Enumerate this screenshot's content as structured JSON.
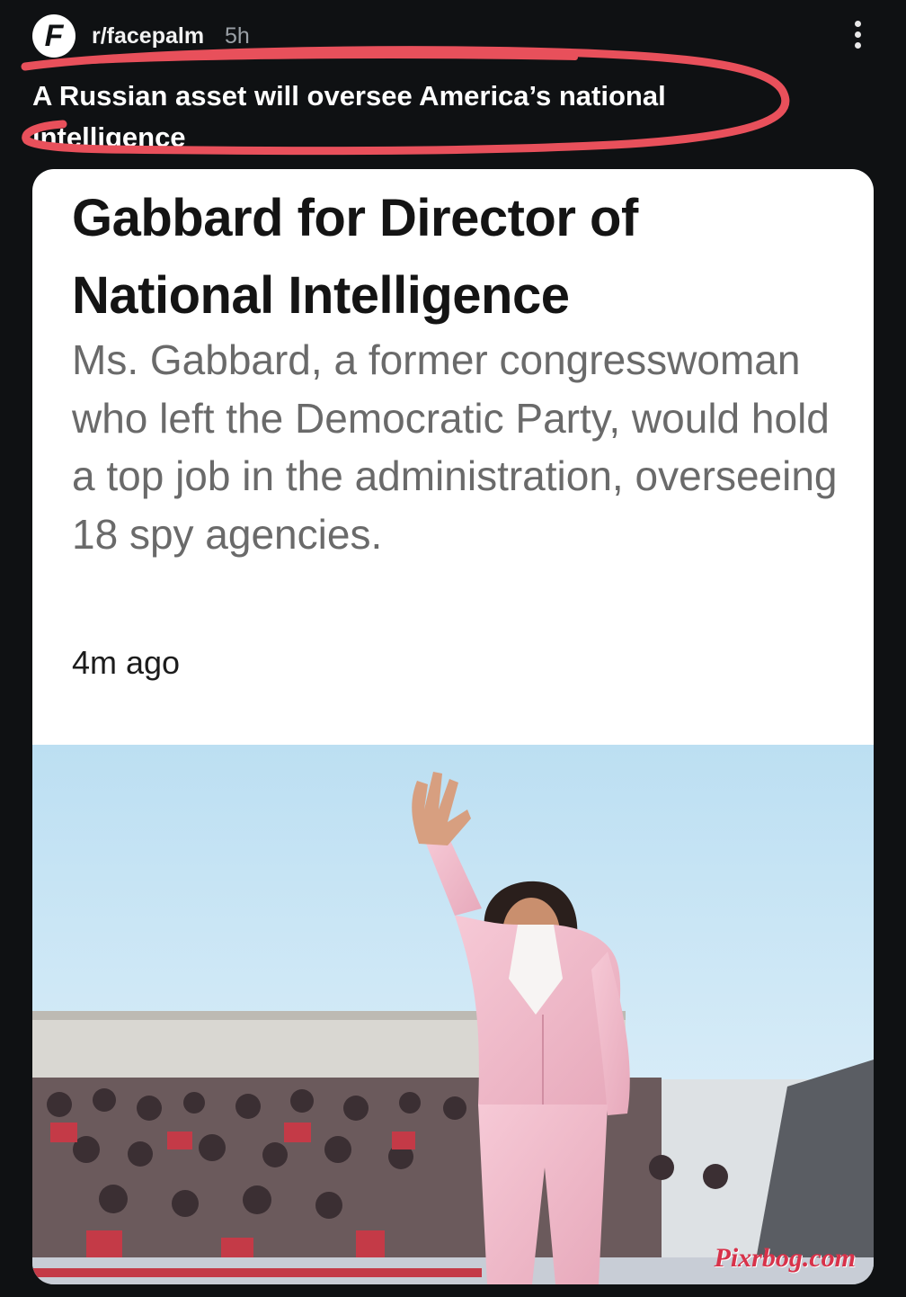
{
  "post": {
    "avatar_letter": "F",
    "subreddit": "r/facepalm",
    "age": "5h",
    "title": "A Russian asset will oversee America’s national intelligence"
  },
  "article": {
    "headline": "Gabbard for Director of National Intelligence",
    "summary": "Ms. Gabbard, a former congresswoman who left the Democratic Party, would hold a top job in the administration, overseeing 18 spy agencies.",
    "timestamp": "4m ago",
    "watermark": "Pixrbog.com"
  },
  "colors": {
    "background": "#0f1113",
    "highlight_stroke": "#e8505b",
    "card": "#ffffff"
  },
  "icons": {
    "more": "more-vertical-icon",
    "avatar": "facepalm-logo-icon"
  }
}
